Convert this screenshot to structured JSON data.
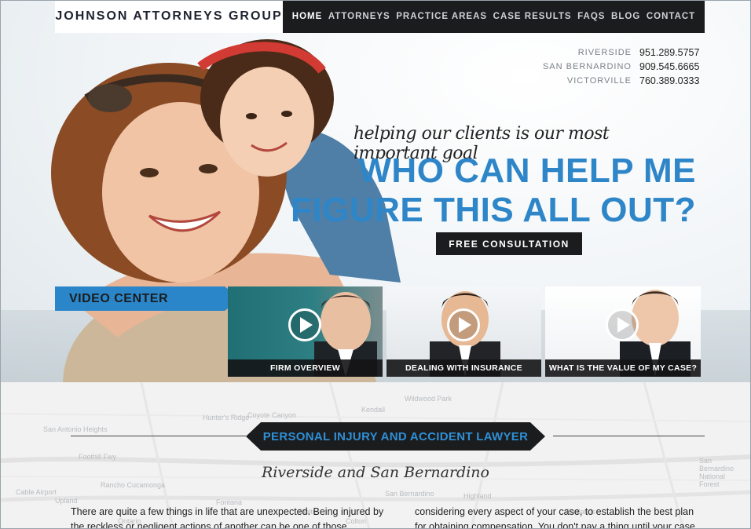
{
  "header": {
    "brand": "JOHNSON ATTORNEYS GROUP",
    "nav": [
      "HOME",
      "ATTORNEYS",
      "PRACTICE AREAS",
      "CASE RESULTS",
      "FAQS",
      "BLOG",
      "CONTACT"
    ],
    "active_nav": "HOME"
  },
  "phones": [
    {
      "city": "RIVERSIDE",
      "number": "951.289.5757"
    },
    {
      "city": "SAN BERNARDINO",
      "number": "909.545.6665"
    },
    {
      "city": "VICTORVILLE",
      "number": "760.389.0333"
    }
  ],
  "hero": {
    "tagline": "helping our clients is our most important goal",
    "headline_line1": "WHO CAN HELP ME",
    "headline_line2": "FIGURE THIS ALL OUT?",
    "cta": "FREE CONSULTATION"
  },
  "video_center": {
    "label": "VIDEO CENTER",
    "videos": [
      {
        "title": "FIRM OVERVIEW"
      },
      {
        "title": "DEALING WITH INSURANCE"
      },
      {
        "title": "WHAT IS THE VALUE OF MY CASE?"
      }
    ]
  },
  "section": {
    "banner": "PERSONAL INJURY AND ACCIDENT LAWYER",
    "subhead": "Riverside and San Bernardino",
    "col1": "There are quite a few things in life that are unexpected. Being injured by the reckless or negligent actions of another can be one of those unexpected and",
    "col2": "considering every aspect of your case, to establish the best plan for obtaining compensation. You don't pay a thing until your case is won."
  },
  "map_labels": [
    "San Antonio Heights",
    "Hunter's Ridge",
    "Coyote Canyon",
    "Kendall",
    "Wildwood Park",
    "Rancho Cucamonga",
    "Fontana",
    "Upland",
    "Ontario",
    "San Bernardino",
    "Highland",
    "Redlands",
    "Rialto",
    "Colton",
    "San Bernardino National Forest",
    "Foothill Fwy",
    "Cable Airport"
  ],
  "colors": {
    "accent": "#2e86c8",
    "dark": "#1b1c1e"
  }
}
